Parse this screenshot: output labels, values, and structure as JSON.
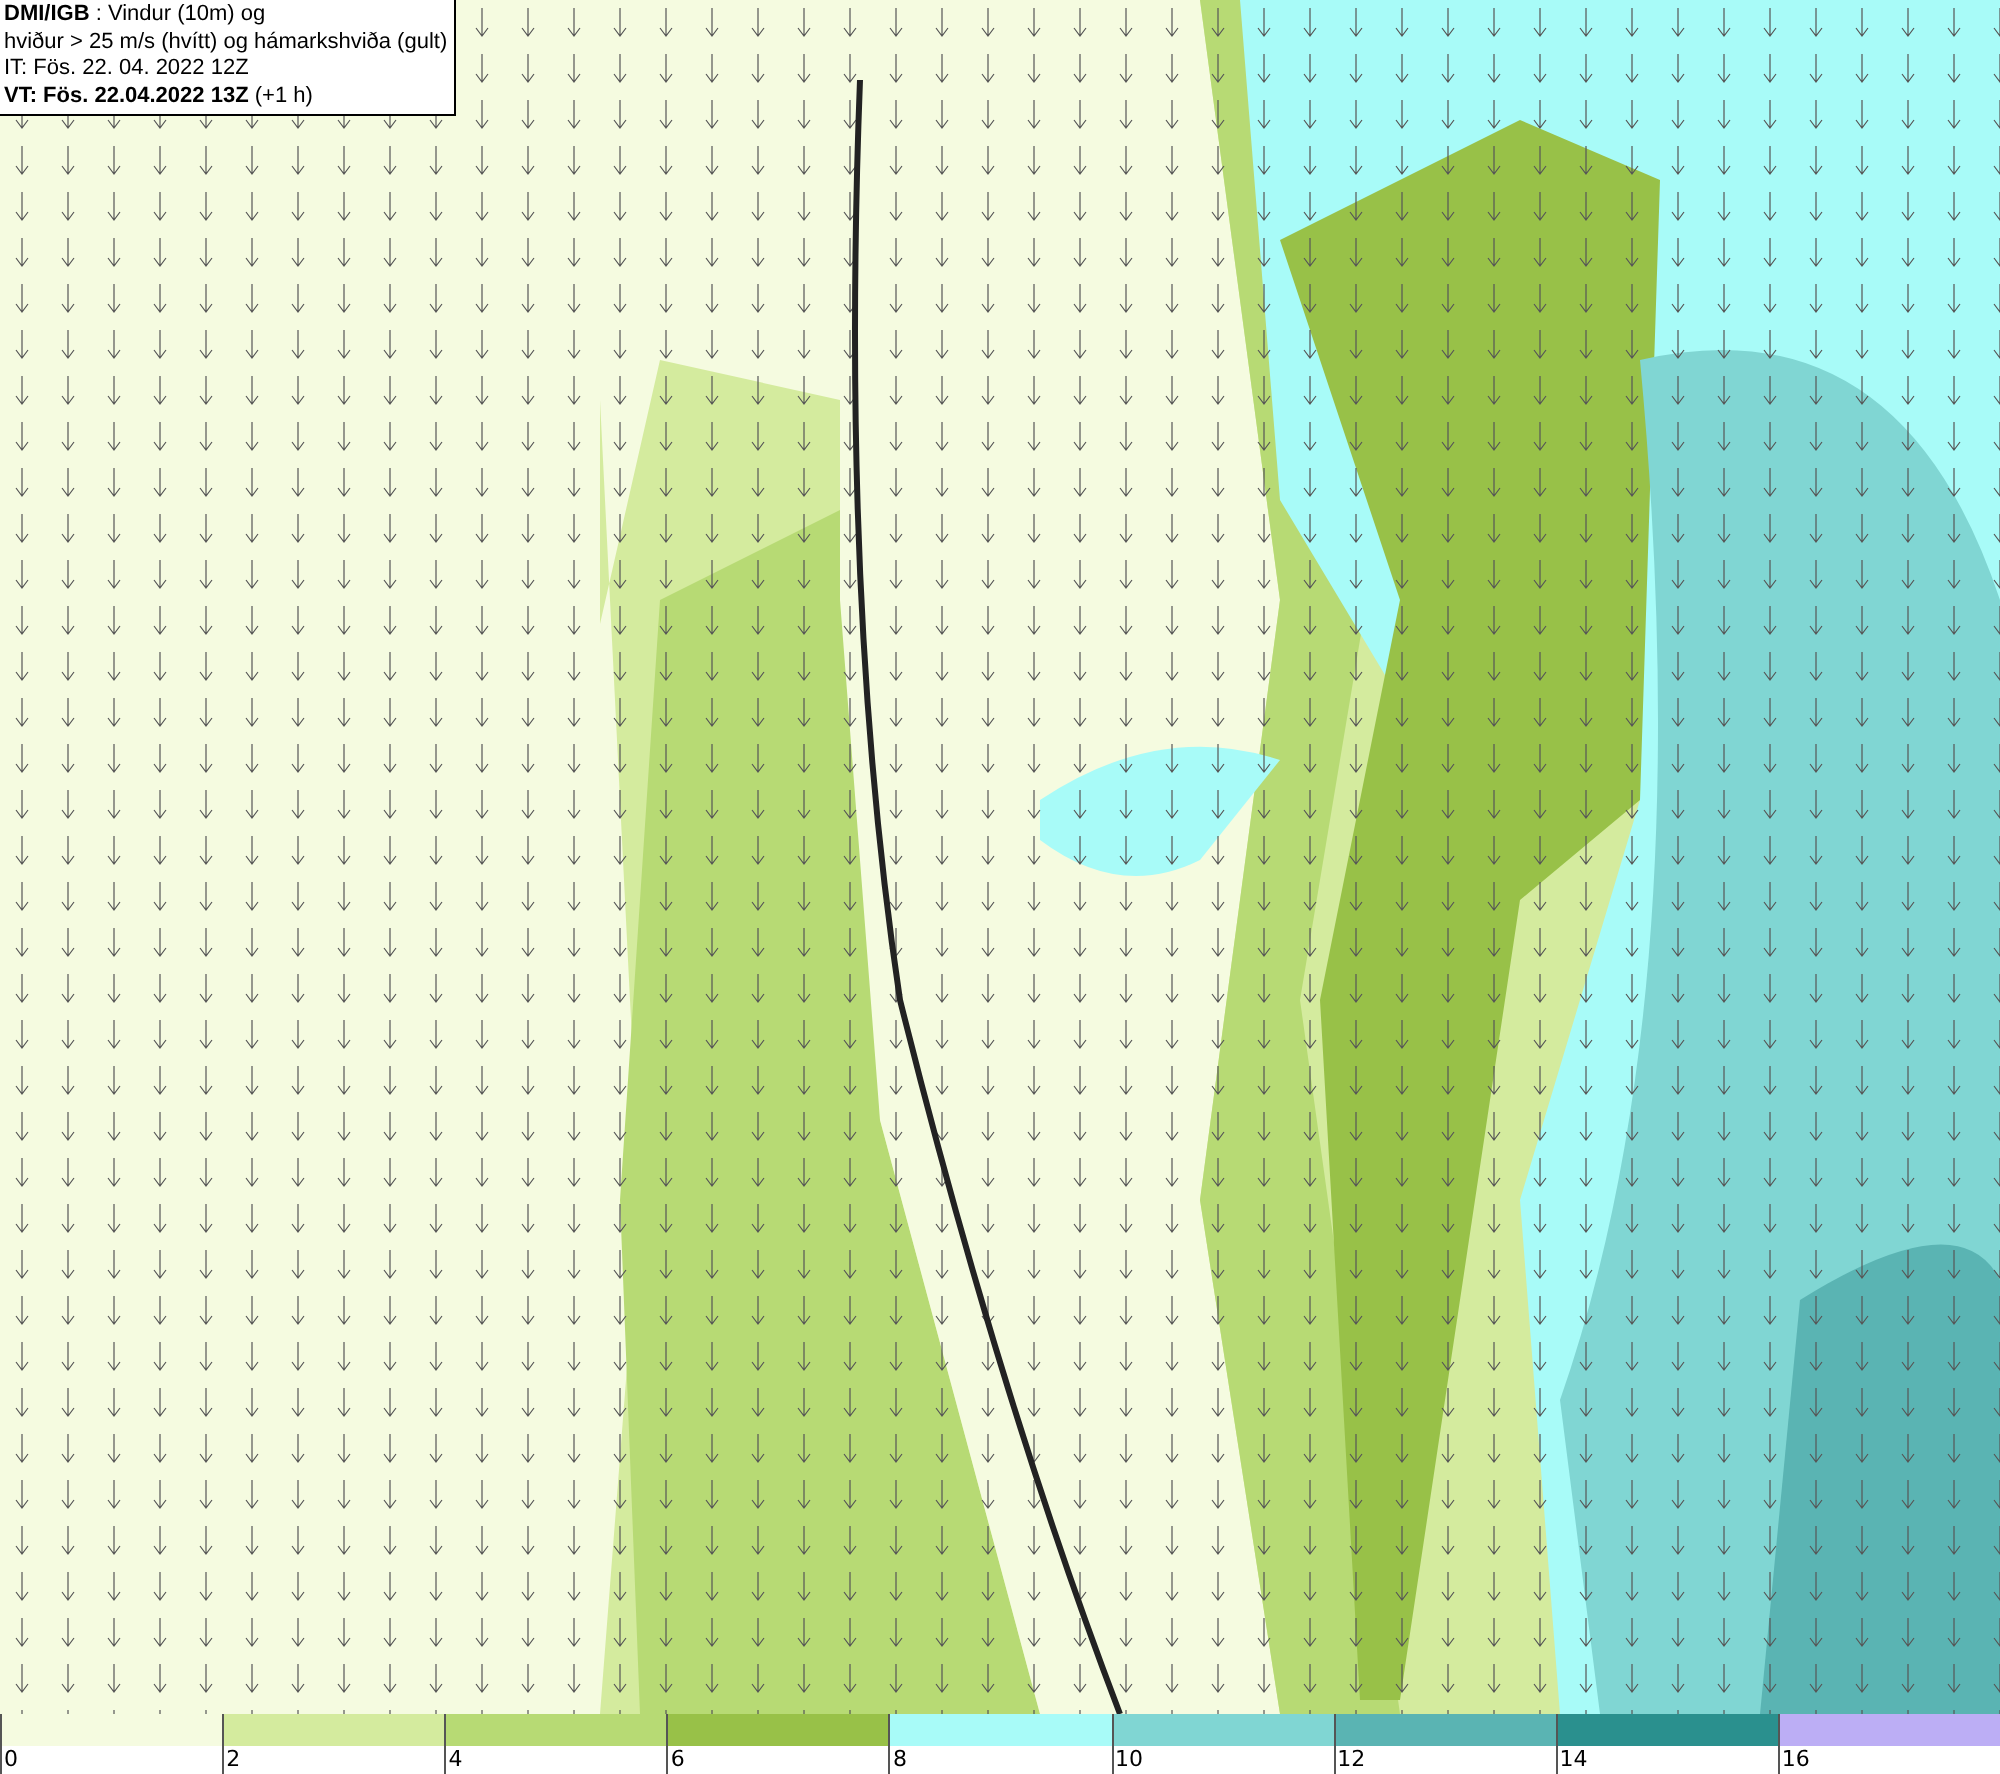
{
  "info_box": {
    "lines": [
      "**DMI/IGB** : Vindur (10m) og",
      "hviður > 25 m/s (hvítt) og hámarkshviða (gult)",
      "IT: Fös. 22. 04. 2022 12Z",
      "**VT: Fös. 22.04.2022 13Z** (+1 h)"
    ]
  },
  "legend": {
    "segments": [
      {
        "color": "#f5fbe0",
        "label": "0"
      },
      {
        "color": "#d4eb9e",
        "label": "2"
      },
      {
        "color": "#b7da74",
        "label": "4"
      },
      {
        "color": "#98c148",
        "label": "6"
      },
      {
        "color": "#a8fbf8",
        "label": "8"
      },
      {
        "color": "#80d6d3",
        "label": "10"
      },
      {
        "color": "#5ab4b3",
        "label": "12"
      },
      {
        "color": "#2a908e",
        "label": "14"
      },
      {
        "color": "#bcaef5",
        "label": "16"
      }
    ]
  }
}
